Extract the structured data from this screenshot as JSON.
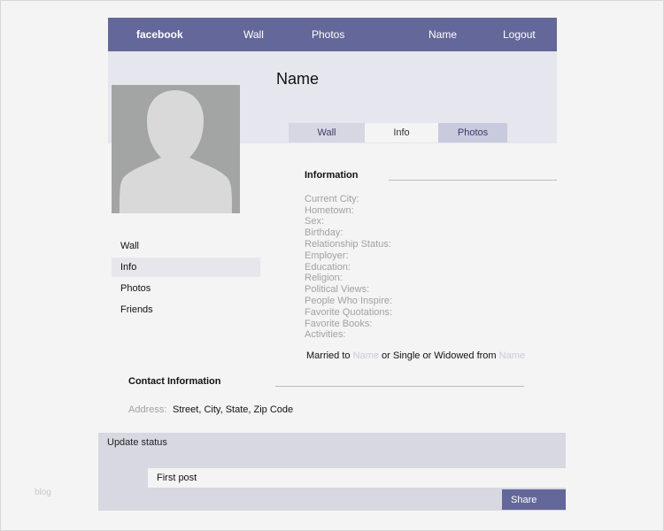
{
  "topbar": {
    "brand": "facebook",
    "items": [
      "Wall",
      "Photos",
      "Name",
      "Logout"
    ]
  },
  "profile": {
    "name": "Name",
    "tabs": [
      "Wall",
      "Info",
      "Photos"
    ],
    "active_tab": "Info"
  },
  "sidebar": {
    "items": [
      "Wall",
      "Info",
      "Photos",
      "Friends"
    ],
    "active_item": "Info"
  },
  "information": {
    "title": "Information",
    "fields": [
      "Current City:",
      "Hometown:",
      "Sex:",
      "Birthday:",
      "Relationship Status:",
      "Employer:",
      "Education:",
      "Religion:",
      "Political Views:",
      "People Who Inspire:",
      "Favorite Quotations:",
      "Favorite Books:",
      "Activities:"
    ],
    "married": {
      "prefix": "Married to ",
      "name1": "Name",
      "middle": " or Single or Widowed from ",
      "name2": "Name"
    }
  },
  "contact": {
    "title": "Contact Information",
    "address_label": "Address:",
    "address_value": "Street, City, State, Zip Code"
  },
  "status": {
    "label": "Update status",
    "input_value": "First post",
    "share_label": "Share"
  },
  "watermark": "blog",
  "colors": {
    "nav_bg": "#64679a",
    "header_bg": "#e6e6ee",
    "page_bg": "#f4f4f4",
    "status_bg": "#d7d8e1",
    "label_gray": "#a1a1a1"
  }
}
